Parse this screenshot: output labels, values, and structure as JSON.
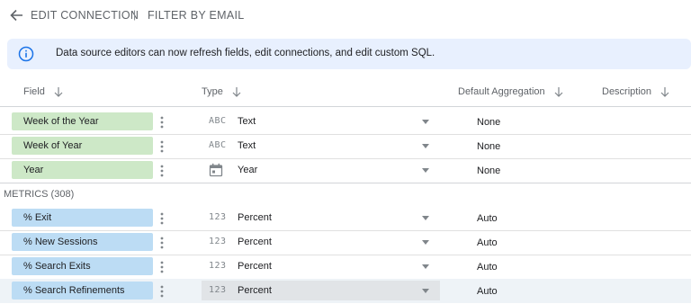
{
  "topbar": {
    "title": "EDIT CONNECTION",
    "separator": "|",
    "filter_label": "FILTER BY EMAIL"
  },
  "banner": {
    "icon": "info-icon",
    "text": "Data source editors can now refresh fields, edit connections, and edit custom SQL."
  },
  "columns": {
    "field": "Field",
    "type": "Type",
    "aggregation": "Default Aggregation",
    "description": "Description"
  },
  "dimensions": [
    {
      "name": "Week of the Year",
      "type_icon": "ABC",
      "type": "Text",
      "aggregation": "None"
    },
    {
      "name": "Week of Year",
      "type_icon": "ABC",
      "type": "Text",
      "aggregation": "None"
    },
    {
      "name": "Year",
      "type_icon": "calendar-icon",
      "type": "Year",
      "aggregation": "None"
    }
  ],
  "metrics_section": "METRICS (308)",
  "metrics": [
    {
      "name": "% Exit",
      "type_icon": "123",
      "type": "Percent",
      "aggregation": "Auto"
    },
    {
      "name": "% New Sessions",
      "type_icon": "123",
      "type": "Percent",
      "aggregation": "Auto"
    },
    {
      "name": "% Search Exits",
      "type_icon": "123",
      "type": "Percent",
      "aggregation": "Auto"
    },
    {
      "name": "% Search Refinements",
      "type_icon": "123",
      "type": "Percent",
      "aggregation": "Auto"
    }
  ],
  "colors": {
    "dimension_chip": "#cde8c7",
    "metric_chip": "#bcdcf4",
    "banner_bg": "#e8f0fe",
    "info_icon": "#1a73e8"
  }
}
